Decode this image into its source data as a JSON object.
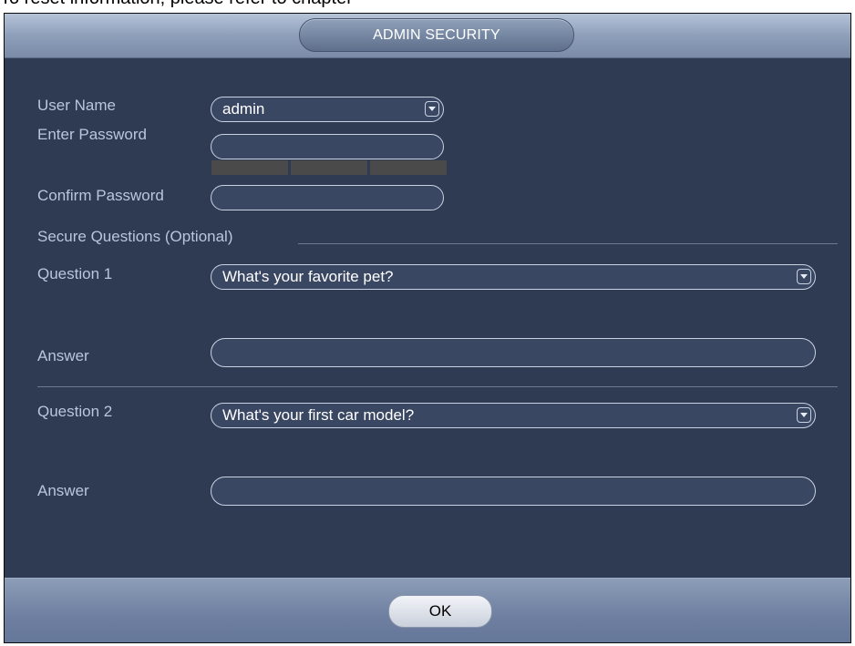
{
  "page": {
    "background_text": "To reset information, please refer to chapter"
  },
  "dialog": {
    "title": "ADMIN SECURITY",
    "colors": {
      "body": "#2f3a53",
      "label": "#b9c6dc",
      "field_border": "#c8d2e2"
    }
  },
  "form": {
    "username_label": "User Name",
    "username_value": "admin",
    "enter_password_label": "Enter Password",
    "enter_password_value": "",
    "confirm_password_label": "Confirm Password",
    "confirm_password_value": "",
    "secure_questions_label": "Secure Questions (Optional)",
    "question1_label": "Question 1",
    "question1_value": "What's your favorite pet?",
    "answer1_label": "Answer",
    "answer1_value": "",
    "question2_label": "Question 2",
    "question2_value": "What's your first car model?",
    "answer2_label": "Answer",
    "answer2_value": ""
  },
  "footer": {
    "ok_label": "OK"
  }
}
